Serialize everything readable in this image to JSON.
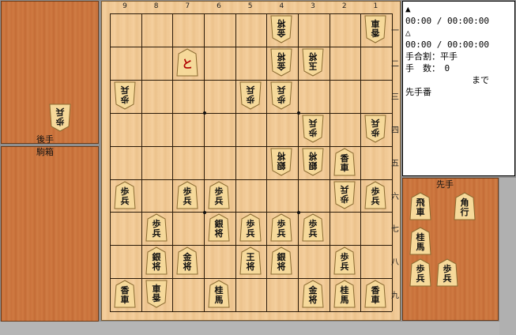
{
  "info": {
    "sente_time": "00:00 / 00:00:00",
    "gote_time": "00:00 / 00:00:00",
    "handicap": "手合割：平手",
    "move_count": "手　数：　0",
    "until": "まで",
    "turn": "先手番",
    "sente_mark": "▲",
    "gote_mark": "△"
  },
  "labels": {
    "gote": "後手",
    "komabako": "駒箱",
    "sente": "先手"
  },
  "board": {
    "files": [
      "9",
      "8",
      "7",
      "6",
      "5",
      "4",
      "3",
      "2",
      "1"
    ],
    "ranks": [
      "一",
      "二",
      "三",
      "四",
      "五",
      "六",
      "七",
      "八",
      "九"
    ],
    "pieces": [
      {
        "file": 4,
        "rank": 1,
        "glyph": "金将",
        "owner": "gote"
      },
      {
        "file": 1,
        "rank": 1,
        "glyph": "香車",
        "owner": "gote"
      },
      {
        "file": 7,
        "rank": 2,
        "glyph": "と",
        "owner": "sente"
      },
      {
        "file": 4,
        "rank": 2,
        "glyph": "金将",
        "owner": "gote"
      },
      {
        "file": 3,
        "rank": 2,
        "glyph": "玉将",
        "owner": "gote"
      },
      {
        "file": 9,
        "rank": 3,
        "glyph": "歩兵",
        "owner": "gote"
      },
      {
        "file": 5,
        "rank": 3,
        "glyph": "歩兵",
        "owner": "gote"
      },
      {
        "file": 4,
        "rank": 3,
        "glyph": "歩兵",
        "owner": "gote"
      },
      {
        "file": 3,
        "rank": 4,
        "glyph": "歩兵",
        "owner": "gote"
      },
      {
        "file": 1,
        "rank": 4,
        "glyph": "歩兵",
        "owner": "gote"
      },
      {
        "file": 4,
        "rank": 5,
        "glyph": "銀将",
        "owner": "gote"
      },
      {
        "file": 3,
        "rank": 5,
        "glyph": "銀将",
        "owner": "gote"
      },
      {
        "file": 2,
        "rank": 5,
        "glyph": "香車",
        "owner": "sente"
      },
      {
        "file": 9,
        "rank": 6,
        "glyph": "歩兵",
        "owner": "sente"
      },
      {
        "file": 7,
        "rank": 6,
        "glyph": "歩兵",
        "owner": "sente"
      },
      {
        "file": 6,
        "rank": 6,
        "glyph": "歩兵",
        "owner": "sente"
      },
      {
        "file": 2,
        "rank": 6,
        "glyph": "歩兵",
        "owner": "gote"
      },
      {
        "file": 1,
        "rank": 6,
        "glyph": "歩兵",
        "owner": "sente"
      },
      {
        "file": 8,
        "rank": 7,
        "glyph": "歩兵",
        "owner": "sente"
      },
      {
        "file": 6,
        "rank": 7,
        "glyph": "銀将",
        "owner": "sente"
      },
      {
        "file": 5,
        "rank": 7,
        "glyph": "歩兵",
        "owner": "sente"
      },
      {
        "file": 4,
        "rank": 7,
        "glyph": "歩兵",
        "owner": "sente"
      },
      {
        "file": 3,
        "rank": 7,
        "glyph": "歩兵",
        "owner": "sente"
      },
      {
        "file": 8,
        "rank": 8,
        "glyph": "銀将",
        "owner": "sente"
      },
      {
        "file": 7,
        "rank": 8,
        "glyph": "金将",
        "owner": "sente"
      },
      {
        "file": 5,
        "rank": 8,
        "glyph": "王将",
        "owner": "sente"
      },
      {
        "file": 4,
        "rank": 8,
        "glyph": "銀将",
        "owner": "sente"
      },
      {
        "file": 2,
        "rank": 8,
        "glyph": "歩兵",
        "owner": "sente"
      },
      {
        "file": 9,
        "rank": 9,
        "glyph": "香車",
        "owner": "sente"
      },
      {
        "file": 8,
        "rank": 9,
        "glyph": "香車",
        "owner": "gote"
      },
      {
        "file": 6,
        "rank": 9,
        "glyph": "桂馬",
        "owner": "sente"
      },
      {
        "file": 3,
        "rank": 9,
        "glyph": "金将",
        "owner": "sente"
      },
      {
        "file": 2,
        "rank": 9,
        "glyph": "桂馬",
        "owner": "sente"
      },
      {
        "file": 1,
        "rank": 9,
        "glyph": "香車",
        "owner": "sente"
      }
    ]
  },
  "hands": {
    "gote": [
      {
        "glyph": "歩兵",
        "owner": "gote",
        "slot": 0
      }
    ],
    "sente": [
      {
        "glyph": "飛車",
        "owner": "sente",
        "slot": 0
      },
      {
        "glyph": "角行",
        "owner": "sente",
        "slot": 1
      },
      {
        "glyph": "桂馬",
        "owner": "sente",
        "slot": 2
      },
      {
        "glyph": "歩兵",
        "owner": "sente",
        "slot": 3
      },
      {
        "glyph": "歩兵",
        "owner": "sente",
        "slot": 4
      }
    ]
  }
}
